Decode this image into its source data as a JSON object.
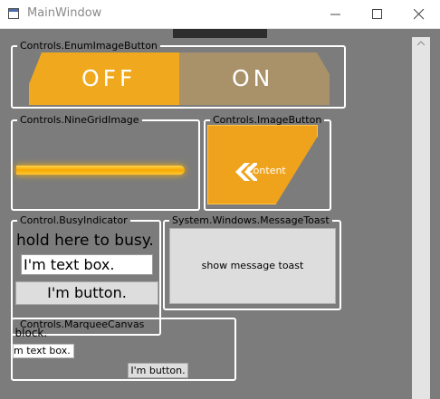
{
  "window": {
    "title": "MainWindow",
    "icons": [
      "app-window-icon",
      "minimize-icon",
      "maximize-icon",
      "close-icon"
    ]
  },
  "groups": {
    "enum_image_button": {
      "title": "Controls.EnumImageButton",
      "off_label": "OFF",
      "on_label": "ON",
      "selected": "OFF"
    },
    "nine_grid_image": {
      "title": "Controls.NineGridImage"
    },
    "image_button": {
      "title": "Controls.ImageButton",
      "content": "Content",
      "icon": "double-chevron-left-icon"
    },
    "busy_indicator": {
      "title": "Control.BusyIndicator",
      "hold_text": "hold here to busy.",
      "textbox_value": "I'm text box.",
      "button_label": "I'm button."
    },
    "message_toast": {
      "title": "System.Windows.MessageToast",
      "button_label": "show message toast"
    },
    "marquee_canvas": {
      "title": "Controls.MarqueeCanvas",
      "text_block": "t block.",
      "textbox_value": "m text box.",
      "button_label": "I'm button."
    }
  },
  "colors": {
    "background": "#7c7c7c",
    "accent_orange": "#f0a91e",
    "on_segment": "#a9916a",
    "group_border": "#ffffff"
  }
}
